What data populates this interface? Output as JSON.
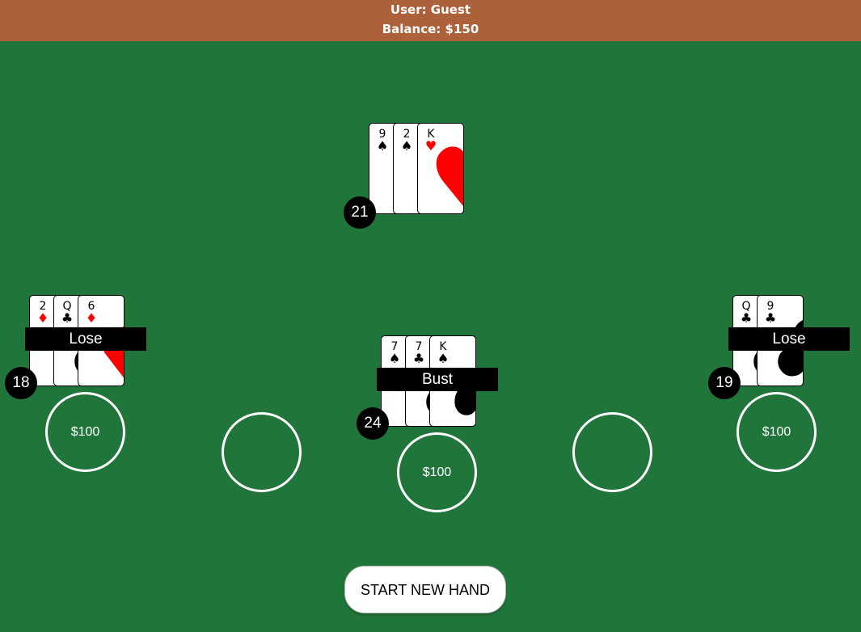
{
  "header": {
    "user": "User: Guest",
    "balance": "Balance: $150"
  },
  "dealer": {
    "score": "21",
    "cards": [
      {
        "rank": "9",
        "suit": "♠"
      },
      {
        "rank": "2",
        "suit": "♠"
      },
      {
        "rank": "K",
        "suit": "♥"
      }
    ]
  },
  "hands": {
    "left": {
      "score": "18",
      "result": "Lose",
      "bet": "$100",
      "cards": [
        {
          "rank": "2",
          "suit": "♦"
        },
        {
          "rank": "Q",
          "suit": "♣"
        },
        {
          "rank": "6",
          "suit": "♦"
        }
      ]
    },
    "center": {
      "score": "24",
      "result": "Bust",
      "bet": "$100",
      "cards": [
        {
          "rank": "7",
          "suit": "♠"
        },
        {
          "rank": "7",
          "suit": "♣"
        },
        {
          "rank": "K",
          "suit": "♠"
        }
      ]
    },
    "right": {
      "score": "19",
      "result": "Lose",
      "bet": "$100",
      "cards": [
        {
          "rank": "Q",
          "suit": "♣"
        },
        {
          "rank": "9",
          "suit": "♣"
        }
      ]
    }
  },
  "empty_spots": [
    {
      "bet": ""
    },
    {
      "bet": ""
    }
  ],
  "controls": {
    "new_hand_label": "START NEW HAND"
  },
  "colors": {
    "table": "#20763a",
    "header": "#ad613a",
    "red_suit": "#ff0000",
    "black_suit": "#000000"
  }
}
